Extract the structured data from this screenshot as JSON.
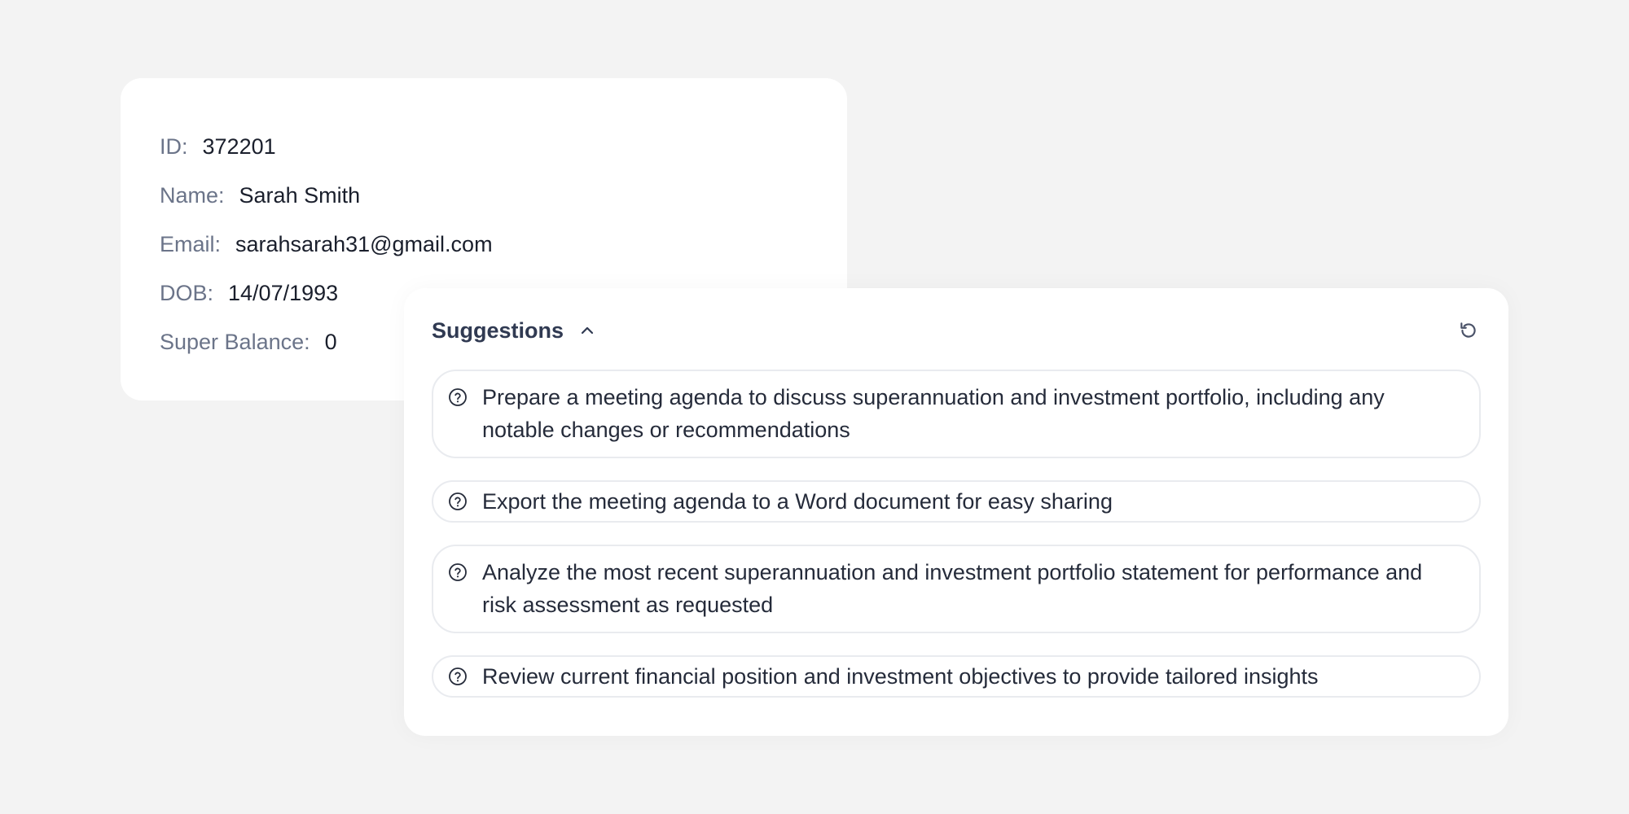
{
  "profile": {
    "fields": [
      {
        "label": "ID:",
        "value": "372201"
      },
      {
        "label": "Name:",
        "value": "Sarah Smith"
      },
      {
        "label": "Email:",
        "value": "sarahsarah31@gmail.com"
      },
      {
        "label": "DOB:",
        "value": "14/07/1993"
      },
      {
        "label": "Super Balance:",
        "value": "0"
      }
    ]
  },
  "suggestions": {
    "title": "Suggestions",
    "icons": {
      "toggle": "chevron-up-icon",
      "refresh": "refresh-icon",
      "item": "help-icon"
    },
    "items": [
      {
        "text": "Prepare a meeting agenda to discuss superannuation and investment portfolio, including any notable changes or recommendations"
      },
      {
        "text": "Export the meeting agenda to a Word document for easy sharing"
      },
      {
        "text": "Analyze the most recent superannuation and investment portfolio statement for performance and risk assessment as requested"
      },
      {
        "text": "Review current financial position and investment objectives to provide tailored insights"
      }
    ]
  },
  "colors": {
    "background": "#f3f3f3",
    "card": "#ffffff",
    "label": "#6b7489",
    "text": "#1a1f2c",
    "border": "#e9ebef"
  }
}
